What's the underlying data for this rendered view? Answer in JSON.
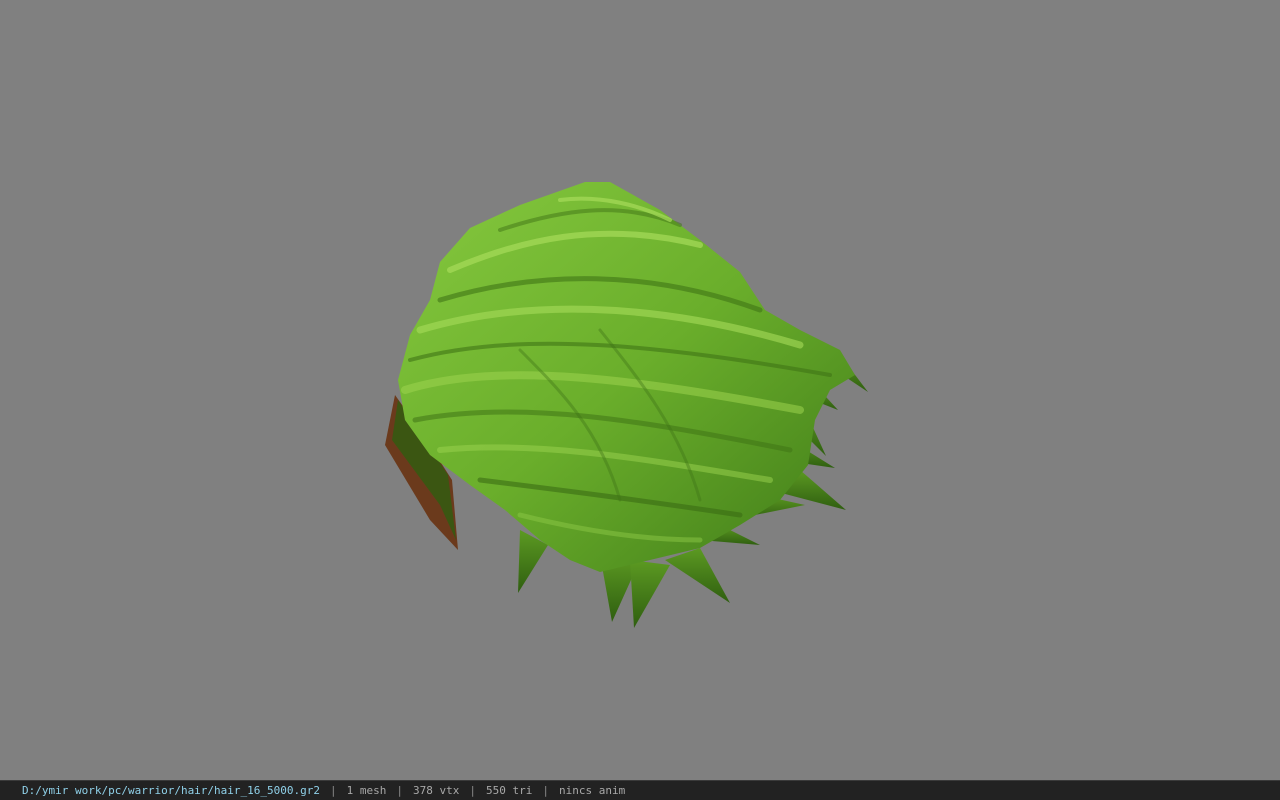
{
  "viewport": {
    "background": "#808080",
    "model_colors": {
      "hair_light": "#7fc23a",
      "hair_mid": "#5e9e25",
      "hair_dark": "#3f7416",
      "scalp": "#6b3a1c"
    }
  },
  "status_bar": {
    "file_path": "D:/ymir work/pc/warrior/hair/hair_16_5000.gr2",
    "separator": "|",
    "mesh_count": "1 mesh",
    "vertex_count": "378 vtx",
    "triangle_count": "550 tri",
    "anim_status": "nincs anim",
    "path_color": "#8fd0e8"
  }
}
